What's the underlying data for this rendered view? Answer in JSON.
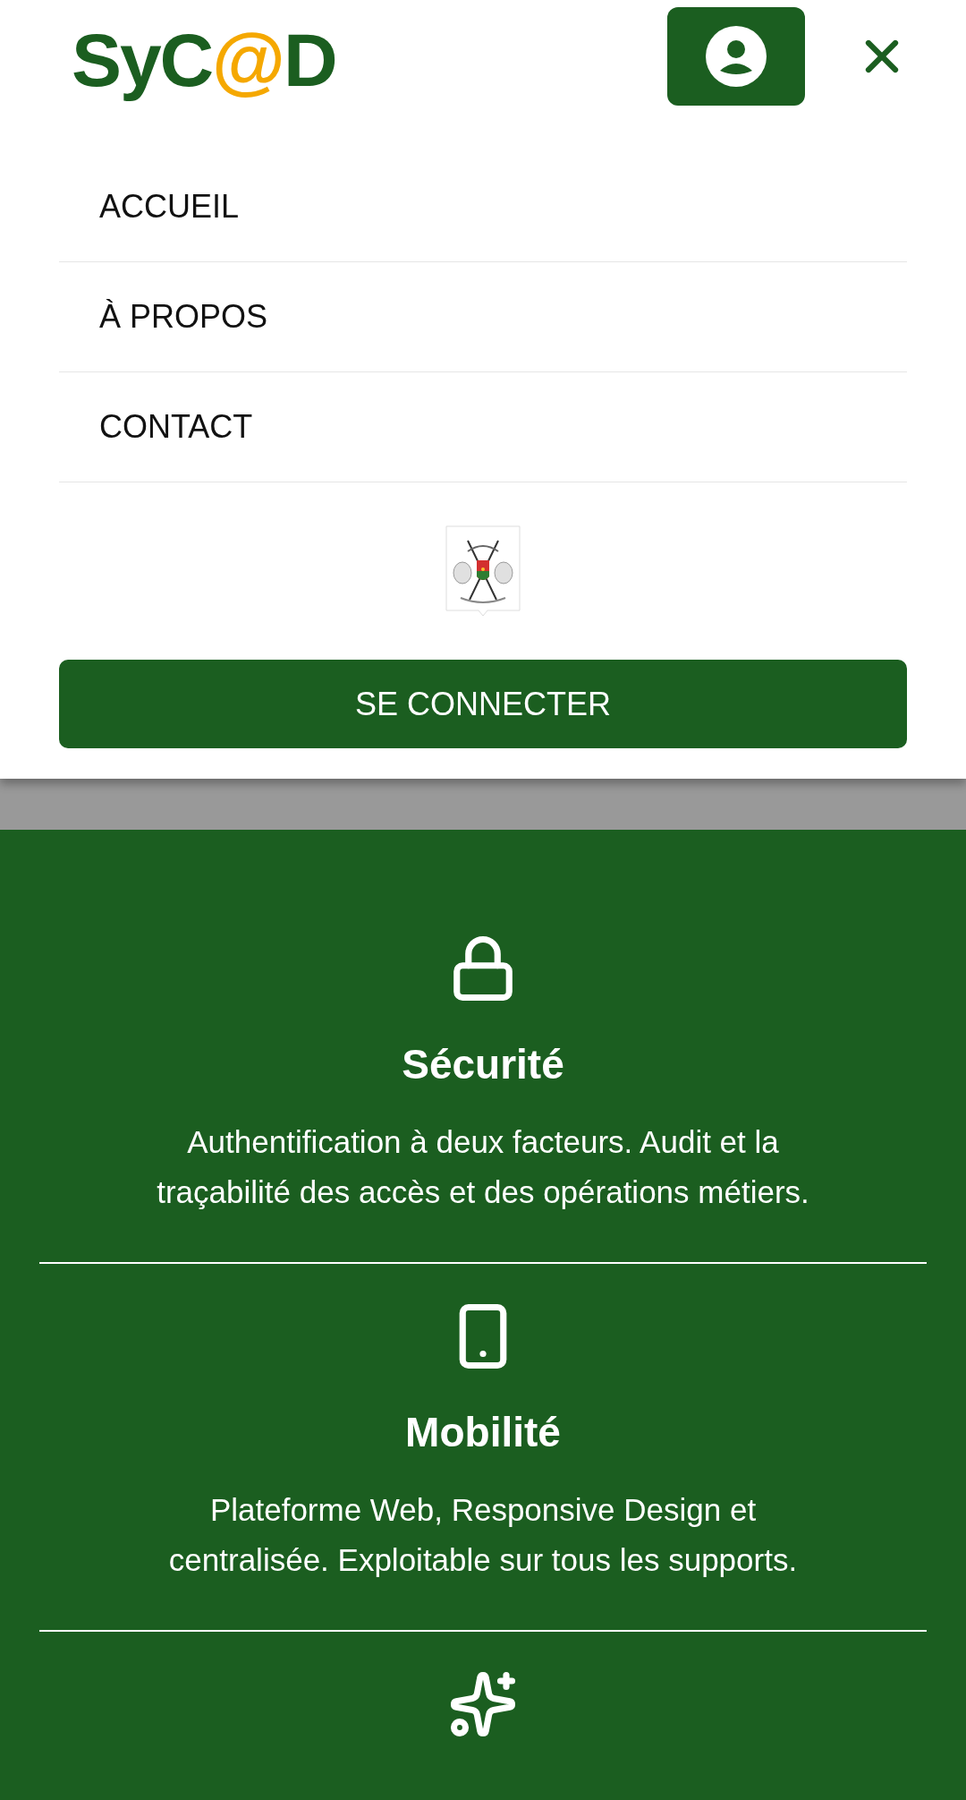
{
  "header": {
    "logo": [
      {
        "text": "SyC",
        "color": "#1b5e20"
      },
      {
        "text": "@",
        "color": "#f5a800"
      },
      {
        "text": "D",
        "color": "#1b5e20"
      }
    ]
  },
  "menu": {
    "items": [
      {
        "label": "ACCUEIL"
      },
      {
        "label": "À PROPOS"
      },
      {
        "label": "CONTACT"
      }
    ],
    "login_button": "SE CONNECTER"
  },
  "features": [
    {
      "kind": "lock",
      "title": "Sécurité",
      "description": "Authentification à deux facteurs. Audit et la traçabilité des accès et des opérations métiers."
    },
    {
      "kind": "phone",
      "title": "Mobilité",
      "description": "Plateforme Web, Responsive Design et centralisée. Exploitable sur tous les supports."
    },
    {
      "kind": "sparkles"
    }
  ]
}
